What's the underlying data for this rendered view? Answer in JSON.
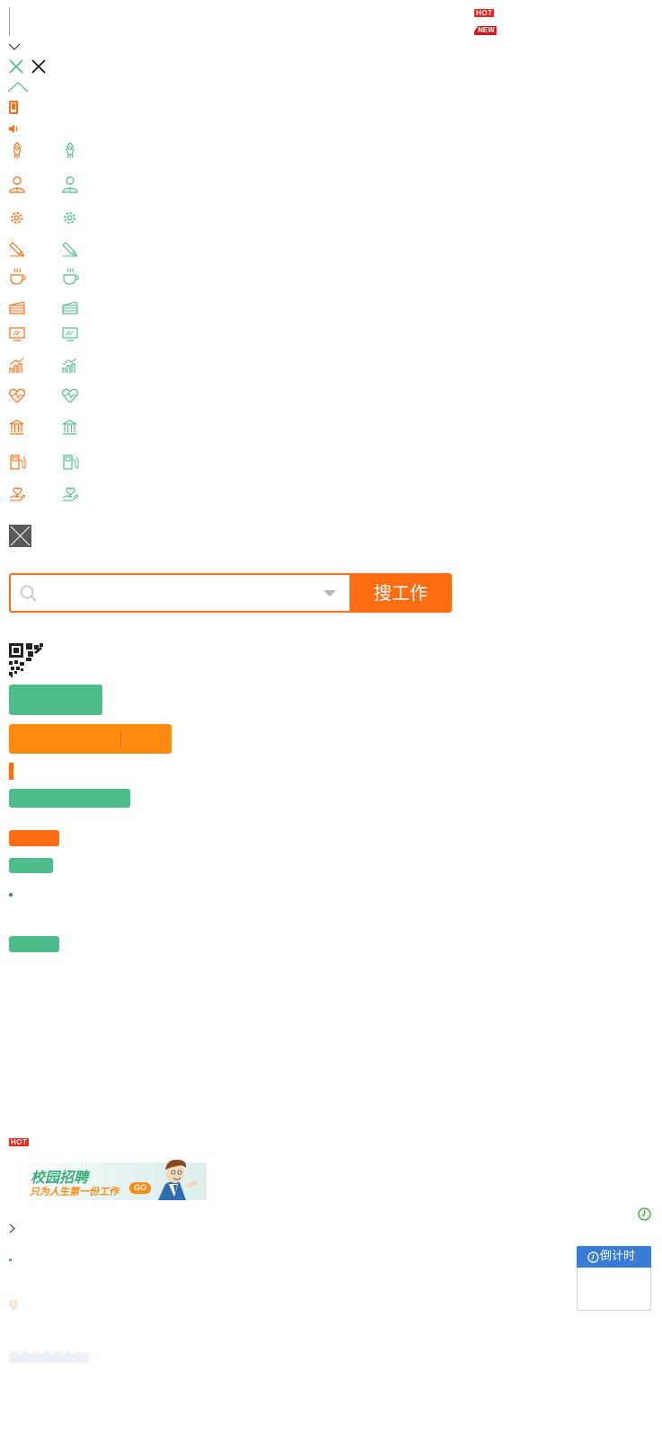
{
  "badges": {
    "hot": "HOT",
    "new": "NEW",
    "hot2": "HOT"
  },
  "search": {
    "button_label": "搜工作",
    "placeholder": ""
  },
  "banner": {
    "title": "校园招聘",
    "subtitle": "只为人生第一份工作",
    "go": "GO"
  },
  "countdown": {
    "label": "倒计时"
  },
  "category_icons": [
    "rocket-icon",
    "person-icon",
    "gear-icon",
    "pen-icon",
    "coffee-icon",
    "clapperboard-icon",
    "monitor-icon",
    "growth-chart-icon",
    "heartbeat-icon",
    "bank-icon",
    "fuel-pump-icon",
    "hand-heart-icon"
  ],
  "colors": {
    "accent_orange": "#ff6d12",
    "accent_green": "#4fbd8b",
    "light_orange": "#ff8a12",
    "blue": "#3a7bd5"
  }
}
